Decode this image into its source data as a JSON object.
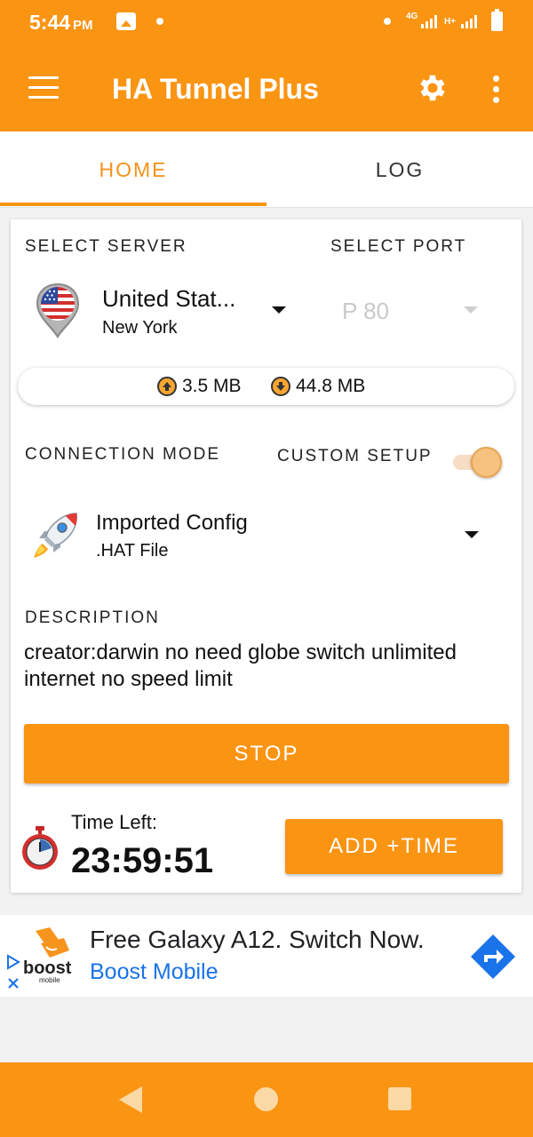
{
  "status_bar": {
    "time": "5:44",
    "ampm": "PM",
    "network_label_1": "4G",
    "network_label_2": "H+"
  },
  "app_bar": {
    "title": "HA Tunnel Plus"
  },
  "tabs": [
    {
      "label": "HOME",
      "active": true
    },
    {
      "label": "LOG",
      "active": false
    }
  ],
  "server": {
    "section_label": "SELECT SERVER",
    "name": "United Stat...",
    "city": "New York",
    "flag_icon": "us-flag-pin-icon"
  },
  "port": {
    "section_label": "SELECT PORT",
    "value": "P 80"
  },
  "traffic": {
    "upload": "3.5 MB",
    "download": "44.8 MB"
  },
  "connection": {
    "section_label": "CONNECTION MODE",
    "custom_setup_label": "CUSTOM SETUP",
    "custom_setup_on": true,
    "mode_name": "Imported Config",
    "mode_sub": ".HAT File"
  },
  "description": {
    "section_label": "DESCRIPTION",
    "text": "creator:darwin no need globe switch unlimited internet no speed limit"
  },
  "actions": {
    "stop_label": "STOP",
    "add_time_label": "ADD +TIME"
  },
  "timer": {
    "label": "Time Left:",
    "value": "23:59:51"
  },
  "ad": {
    "headline": "Free Galaxy A12. Switch Now.",
    "advertiser": "Boost Mobile",
    "logo_text": "boost",
    "logo_sub": "mobile"
  },
  "colors": {
    "accent": "#fa9413",
    "ad_link": "#1a73e8"
  }
}
